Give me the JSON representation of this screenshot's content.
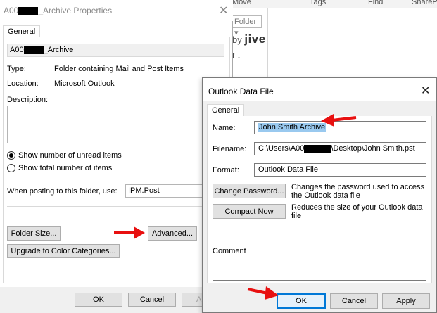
{
  "background": {
    "columns": [
      "Move",
      "Tags",
      "Find",
      "SharePoint"
    ],
    "folder_dropdown": "Folder",
    "jive_prefix": "by",
    "jive_brand": "jive",
    "sort_glyph": "t ↓"
  },
  "properties_dialog": {
    "title_prefix": "A00",
    "title_suffix": "_Archive Properties",
    "tab_general": "General",
    "name_prefix": "A00",
    "name_suffix": "_Archive",
    "type_label": "Type:",
    "type_value": "Folder containing Mail and Post Items",
    "location_label": "Location:",
    "location_value": "Microsoft Outlook",
    "description_label": "Description:",
    "radio_unread": "Show number of unread items",
    "radio_total": "Show total number of items",
    "posting_label": "When posting to this folder, use:",
    "posting_value": "IPM.Post",
    "folder_size_button": "Folder Size...",
    "advanced_button": "Advanced...",
    "upgrade_button": "Upgrade to Color Categories...",
    "ok_button": "OK",
    "cancel_button": "Cancel",
    "apply_button": "Ap"
  },
  "data_file_dialog": {
    "title": "Outlook Data File",
    "tab_general": "General",
    "name_label": "Name:",
    "name_value": "John  Smith Archive",
    "filename_label": "Filename:",
    "filename_prefix": "C:\\Users\\A00",
    "filename_suffix": "\\Desktop\\John Smith.pst",
    "format_label": "Format:",
    "format_value": "Outlook Data File",
    "change_password_button": "Change Password...",
    "change_password_desc": "Changes the password used to access the Outlook data file",
    "compact_now_button": "Compact Now",
    "compact_now_desc": "Reduces the size of your Outlook data file",
    "comment_label": "Comment",
    "ok_button": "OK",
    "cancel_button": "Cancel",
    "apply_button": "Apply"
  },
  "colors": {
    "annotation_arrow": "#e81010",
    "selection": "#99c9ef",
    "default_button_border": "#0078d7"
  }
}
